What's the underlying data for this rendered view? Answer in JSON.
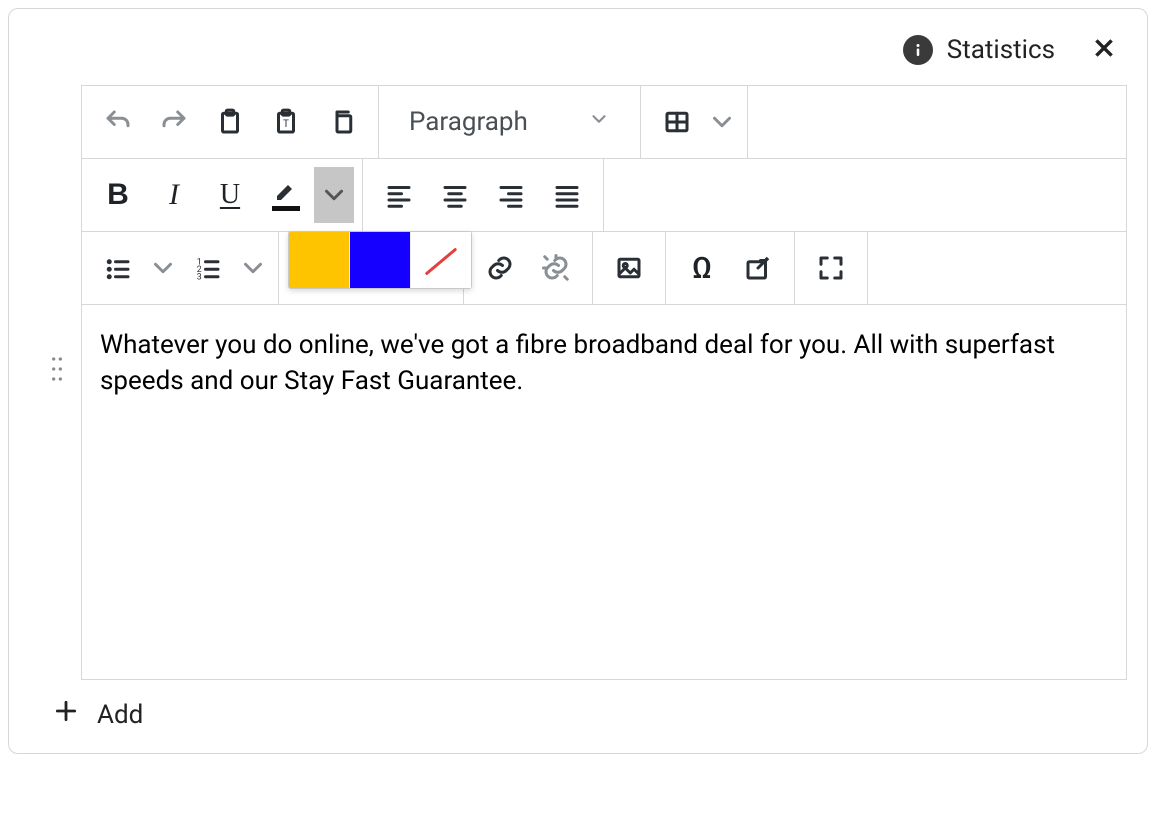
{
  "header": {
    "statistics_label": "Statistics"
  },
  "toolbar": {
    "block_format": "Paragraph"
  },
  "highlight_popover": {
    "colors": [
      "#ffc400",
      "#1500ff"
    ]
  },
  "editor": {
    "content": "Whatever you do online, we've got a fibre broadband deal for you. All with superfast speeds and our Stay Fast Guarantee."
  },
  "footer": {
    "add_label": "Add"
  }
}
